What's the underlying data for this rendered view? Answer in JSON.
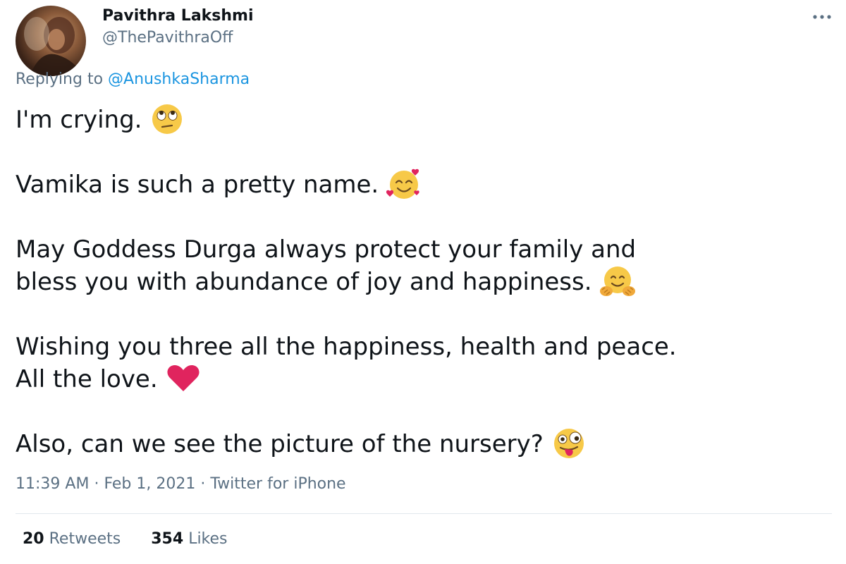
{
  "user": {
    "display_name": "Pavithra Lakshmi",
    "handle": "@ThePavithraOff"
  },
  "reply": {
    "prefix": "Replying to",
    "mention": "@AnushkaSharma"
  },
  "body": {
    "line1": "I'm crying.",
    "line2": "Vamika is such a pretty name.",
    "line3": "May Goddess Durga always protect your family and",
    "line4": "bless you with abundance of joy and happiness.",
    "line5": "Wishing you three all the happiness, health and peace.",
    "line6": "All the love.",
    "line7": "Also, can we see the picture of the nursery?"
  },
  "emojis": {
    "line1": "face-with-rolling-eyes-icon",
    "line2": "smiling-face-with-hearts-icon",
    "line4": "hugging-face-icon",
    "line6": "red-heart-icon",
    "line7": "zany-face-icon"
  },
  "meta": {
    "time": "11:39 AM",
    "separator": "·",
    "date": "Feb 1, 2021",
    "source": "Twitter for iPhone"
  },
  "stats": {
    "retweets_count": "20",
    "retweets_label": "Retweets",
    "likes_count": "354",
    "likes_label": "Likes"
  },
  "colors": {
    "text": "#0f1419",
    "secondary": "#5b7083",
    "link": "#1b95e0",
    "heart": "#e0245e"
  }
}
